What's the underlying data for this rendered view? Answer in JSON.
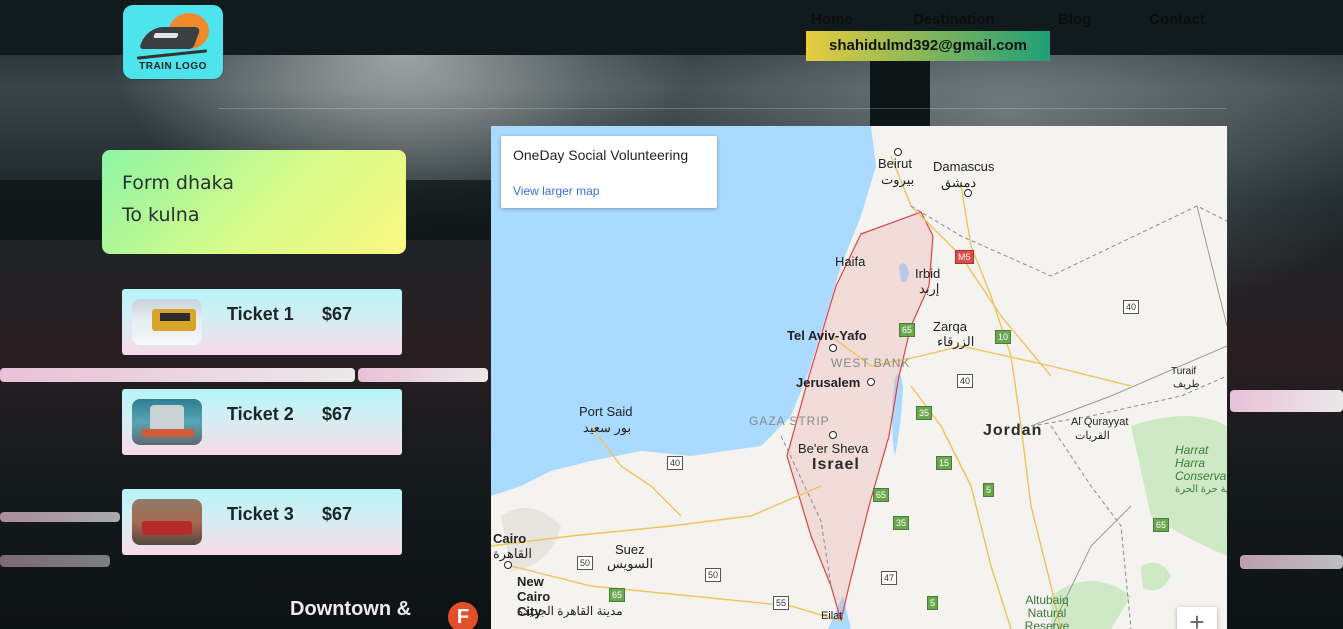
{
  "header": {
    "logo_text": "TRAIN LOGO",
    "nav": [
      "Home",
      "Destination",
      "Blog",
      "Contact"
    ],
    "email": "shahidulmd392@gmail.com"
  },
  "route": {
    "from": "Form dhaka",
    "to": "To kulna"
  },
  "tickets": [
    {
      "name": "Ticket 1",
      "price": "$67"
    },
    {
      "name": "Ticket 2",
      "price": "$67"
    },
    {
      "name": "Ticket 3",
      "price": "$67"
    }
  ],
  "background": {
    "sign_text": "Downtown &",
    "sign_letter": "F"
  },
  "map": {
    "title": "OneDay Social Volunteering",
    "link": "View larger map",
    "zoom_in": "+",
    "labels": {
      "beirut": "Beirut",
      "beirut_ar": "بيروت",
      "damascus": "Damascus",
      "damascus_ar": "دمشق",
      "haifa": "Haifa",
      "irbid": "Irbid",
      "irbid_ar": "إربد",
      "telaviv": "Tel Aviv-Yafo",
      "zarqa": "Zarqa",
      "zarqa_ar": "الزرقاء",
      "westbank": "WEST BANK",
      "jerusalem": "Jerusalem",
      "portsaid": "Port Said",
      "portsaid_ar": "بور سعيد",
      "gaza": "GAZA STRIP",
      "beersheva": "Be'er Sheva",
      "israel": "Israel",
      "jordan": "Jordan",
      "turaif": "Turaif",
      "turaif_ar": "طريف",
      "alqurayyat": "Al Qurayyat",
      "alqurayyat_ar": "القريات",
      "harrat": "Harrat Harra Conserva",
      "harrat_ar": "محمية حرة الحرة",
      "cairo": "Cairo",
      "cairo_ar": "القاهرة",
      "suez": "Suez",
      "suez_ar": "السويس",
      "newcairo": "New Cairo City",
      "newcairo_ar": "مدينة القاهرة الجديدة",
      "eilat": "Eilat",
      "albaiq": "Altubaiq Natural Reserve"
    },
    "shields": [
      "M5",
      "40",
      "65",
      "10",
      "35",
      "40",
      "15",
      "65",
      "35",
      "5",
      "65",
      "50",
      "50",
      "55",
      "47",
      "5",
      "65",
      "40"
    ]
  },
  "colors": {
    "email_gradient": [
      "#e7cc3e",
      "#1f9f78"
    ],
    "route_gradient": [
      "#8df4a4",
      "#fbf882"
    ],
    "ticket_gradient": [
      "#b6f5f7",
      "#f7dbe9"
    ],
    "logo_bg": "#4ee4ee",
    "water": "#aadaff"
  }
}
